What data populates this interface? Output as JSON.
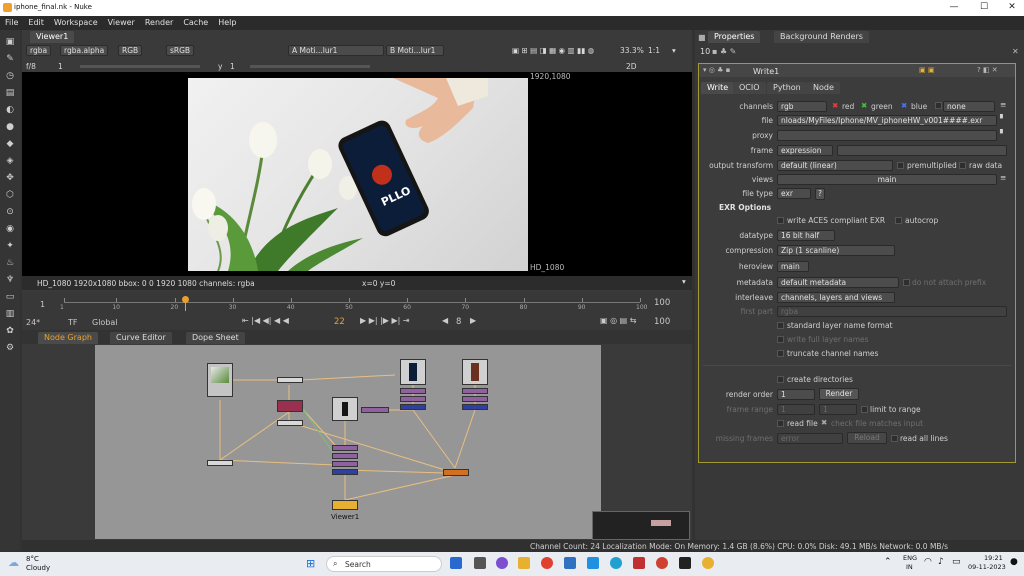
{
  "window": {
    "title": "iphone_final.nk - Nuke"
  },
  "menu": [
    "File",
    "Edit",
    "Workspace",
    "Viewer",
    "Render",
    "Cache",
    "Help"
  ],
  "viewer": {
    "tab": "Viewer1",
    "channels": "rgba",
    "alpha": "rgba.alpha",
    "color": "RGB",
    "colorspace": "sRGB",
    "input_a": "A  Moti...lur1",
    "input_b": "B  Moti...lur1",
    "zoom_pct": "33.3%",
    "ratio": "1:1",
    "fstop": "f/8",
    "gain_mark": "1",
    "gamma_label": "y",
    "gamma_value": "1",
    "view_mode": "2D",
    "corner_tr": "1920,1080",
    "corner_br": "HD_1080",
    "info": "HD_1080 1920x1080  bbox: 0 0 1920 1080 channels: rgba",
    "coords": "x=0 y=0",
    "phone_text": "PLLO"
  },
  "timeline": {
    "start": "1",
    "end": "100",
    "ticks": [
      "1",
      "10",
      "20",
      "30",
      "40",
      "50",
      "60",
      "70",
      "80",
      "90",
      "100"
    ],
    "fps": "24*",
    "tf": "TF",
    "scope": "Global",
    "current_frame": "22",
    "step": "8",
    "end_frame": "100"
  },
  "nodegraph": {
    "tabs": [
      "Node Graph",
      "Curve Editor",
      "Dope Sheet"
    ],
    "viewer_node": "Viewer1"
  },
  "properties": {
    "tabs": [
      "Properties",
      "Background Renders"
    ],
    "max_panels": "10",
    "node_name": "Write1",
    "subtabs": [
      "Write",
      "OCIO",
      "Python",
      "Node"
    ],
    "channels_label": "channels",
    "channels_value": "rgb",
    "ch_red": "red",
    "ch_green": "green",
    "ch_blue": "blue",
    "ch_none": "none",
    "file_label": "file",
    "file_value": "nloads/MyFiles/Iphone/MV_iphoneHW_v001####.exr",
    "proxy_label": "proxy",
    "frame_label": "frame",
    "frame_value": "expression",
    "output_transform_label": "output transform",
    "output_transform_value": "default (linear)",
    "premultiplied": "premultiplied",
    "raw_data": "raw data",
    "views_label": "views",
    "views_value": "main",
    "file_type_label": "file type",
    "file_type_value": "exr",
    "help": "?",
    "exr_options": "EXR Options",
    "aces": "write ACES compliant EXR",
    "autocrop": "autocrop",
    "datatype_label": "datatype",
    "datatype_value": "16 bit half",
    "compression_label": "compression",
    "compression_value": "Zip (1 scanline)",
    "heroview_label": "heroview",
    "heroview_value": "main",
    "metadata_label": "metadata",
    "metadata_value": "default metadata",
    "no_prefix": "do not attach prefix",
    "interleave_label": "interleave",
    "interleave_value": "channels, layers and views",
    "first_part_label": "first part",
    "first_part_value": "rgba",
    "std_layer": "standard layer name format",
    "write_full_layer": "write full layer names",
    "truncate": "truncate channel names",
    "create_dirs": "create directories",
    "render_order_label": "render order",
    "render_order_value": "1",
    "render_btn": "Render",
    "frame_range_label": "frame range",
    "frame_range_a": "1",
    "frame_range_b": "1",
    "limit_range": "limit to range",
    "read_file": "read file",
    "check_file": "check file matches input",
    "missing_label": "missing frames",
    "missing_value": "error",
    "reload_btn": "Reload",
    "read_all": "read all lines"
  },
  "status": "Channel Count: 24  Localization Mode: On  Memory: 1.4 GB (8.6%)  CPU: 0.0%  Disk: 49.1 MB/s  Network: 0.0 MB/s",
  "taskbar": {
    "temp": "8°C",
    "weather": "Cloudy",
    "search": "Search",
    "lang1": "ENG",
    "lang2": "IN",
    "time": "19:21",
    "date": "09-11-2023"
  },
  "colors": {
    "accent_orange": "#e8a030",
    "panel_border": "#a39a2e",
    "viewer_bg": "#000000",
    "nodegraph_bg": "#969696"
  }
}
